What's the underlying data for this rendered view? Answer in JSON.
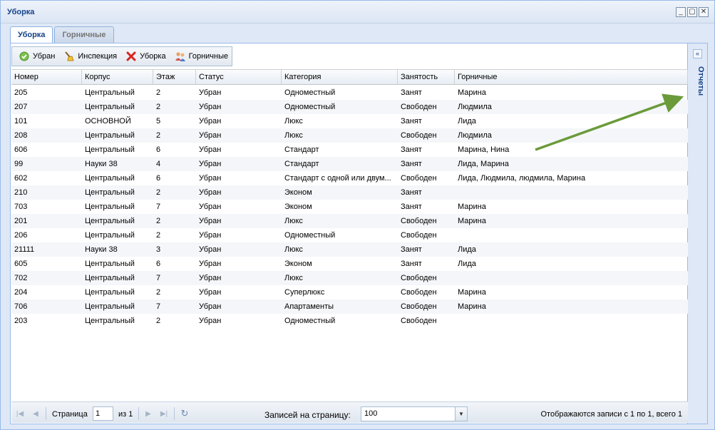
{
  "window": {
    "title": "Уборка"
  },
  "tabs": [
    {
      "label": "Уборка",
      "active": true
    },
    {
      "label": "Горничные",
      "active": false
    }
  ],
  "toolbar": {
    "buttons": [
      {
        "label": "Убран",
        "icon": "check-circle-icon"
      },
      {
        "label": "Инспекция",
        "icon": "broom-icon"
      },
      {
        "label": "Уборка",
        "icon": "red-x-icon"
      },
      {
        "label": "Горничные",
        "icon": "users-icon"
      }
    ]
  },
  "grid": {
    "columns": [
      "Номер",
      "Корпус",
      "Этаж",
      "Статус",
      "Категория",
      "Занятость",
      "Горничные"
    ],
    "rows": [
      [
        "205",
        "Центральный",
        "2",
        "Убран",
        "Одноместный",
        "Занят",
        "Марина"
      ],
      [
        "207",
        "Центральный",
        "2",
        "Убран",
        "Одноместный",
        "Свободен",
        "Людмила"
      ],
      [
        "101",
        "ОСНОВНОЙ",
        "5",
        "Убран",
        "Люкс",
        "Занят",
        "Лида"
      ],
      [
        "208",
        "Центральный",
        "2",
        "Убран",
        "Люкс",
        "Свободен",
        "Людмила"
      ],
      [
        "606",
        "Центральный",
        "6",
        "Убран",
        "Стандарт",
        "Занят",
        "Марина, Нина"
      ],
      [
        "99",
        "Науки 38",
        "4",
        "Убран",
        "Стандарт",
        "Занят",
        "Лида, Марина"
      ],
      [
        "602",
        "Центральный",
        "6",
        "Убран",
        "Стандарт с одной или двум...",
        "Свободен",
        "Лида, Людмила, людмила, Марина"
      ],
      [
        "210",
        "Центральный",
        "2",
        "Убран",
        "Эконом",
        "Занят",
        ""
      ],
      [
        "703",
        "Центральный",
        "7",
        "Убран",
        "Эконом",
        "Занят",
        "Марина"
      ],
      [
        "201",
        "Центральный",
        "2",
        "Убран",
        "Люкс",
        "Свободен",
        "Марина"
      ],
      [
        "206",
        "Центральный",
        "2",
        "Убран",
        "Одноместный",
        "Свободен",
        ""
      ],
      [
        "21111",
        "Науки 38",
        "3",
        "Убран",
        "Люкс",
        "Занят",
        "Лида"
      ],
      [
        "605",
        "Центральный",
        "6",
        "Убран",
        "Эконом",
        "Занят",
        "Лида"
      ],
      [
        "702",
        "Центральный",
        "7",
        "Убран",
        "Люкс",
        "Свободен",
        ""
      ],
      [
        "204",
        "Центральный",
        "2",
        "Убран",
        "Суперлюкс",
        "Свободен",
        "Марина"
      ],
      [
        "706",
        "Центральный",
        "7",
        "Убран",
        "Апартаменты",
        "Свободен",
        "Марина"
      ],
      [
        "203",
        "Центральный",
        "2",
        "Убран",
        "Одноместный",
        "Свободен",
        ""
      ]
    ]
  },
  "pager": {
    "page_label": "Страница",
    "page_value": "1",
    "of_label": "из 1",
    "per_page_label": "Записей на страницу:",
    "per_page_value": "100",
    "display_msg": "Отображаются записи с 1 по 1, всего 1"
  },
  "side_panel": {
    "title": "Отчеты"
  },
  "colors": {
    "accent": "#15428b",
    "arrow": "#6a9a3a"
  }
}
